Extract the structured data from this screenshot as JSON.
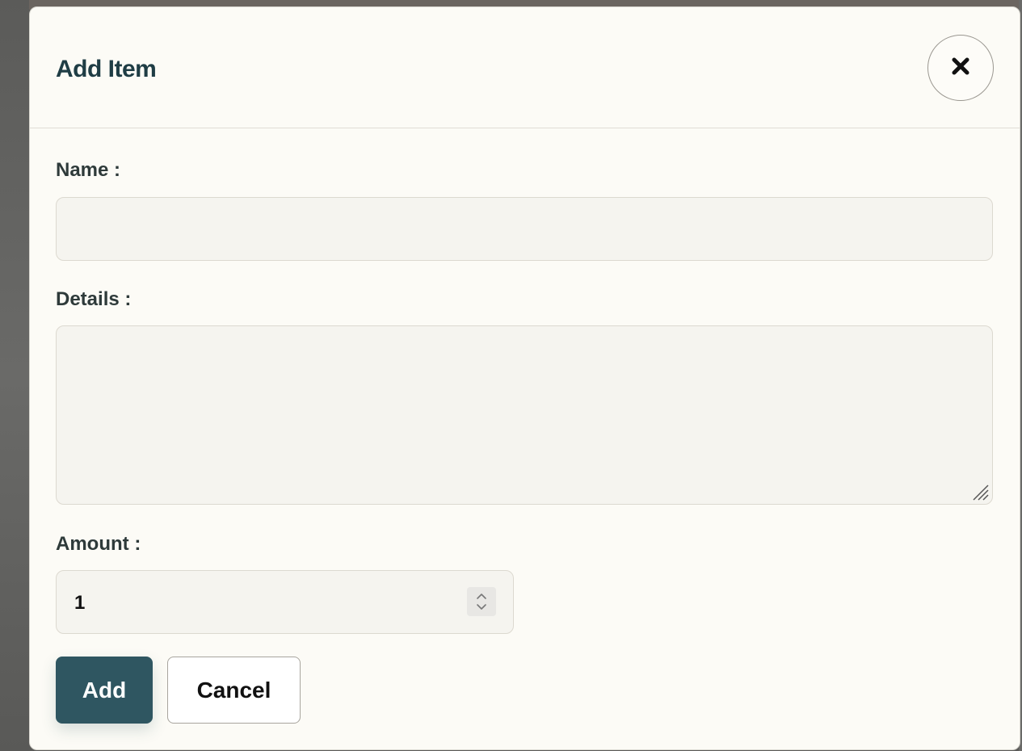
{
  "modal": {
    "title": "Add Item",
    "close_icon": "close-icon"
  },
  "form": {
    "name": {
      "label": "Name :",
      "value": "",
      "placeholder": ""
    },
    "details": {
      "label": "Details :",
      "value": "",
      "placeholder": ""
    },
    "amount": {
      "label": "Amount :",
      "value": "1",
      "stepper_icon": "chevron-up-down-icon"
    }
  },
  "actions": {
    "add_label": "Add",
    "cancel_label": "Cancel"
  },
  "colors": {
    "primary": "#2f5661",
    "title": "#1f3d45",
    "background": "#fcfbf6",
    "input_background": "#f5f4ef"
  }
}
